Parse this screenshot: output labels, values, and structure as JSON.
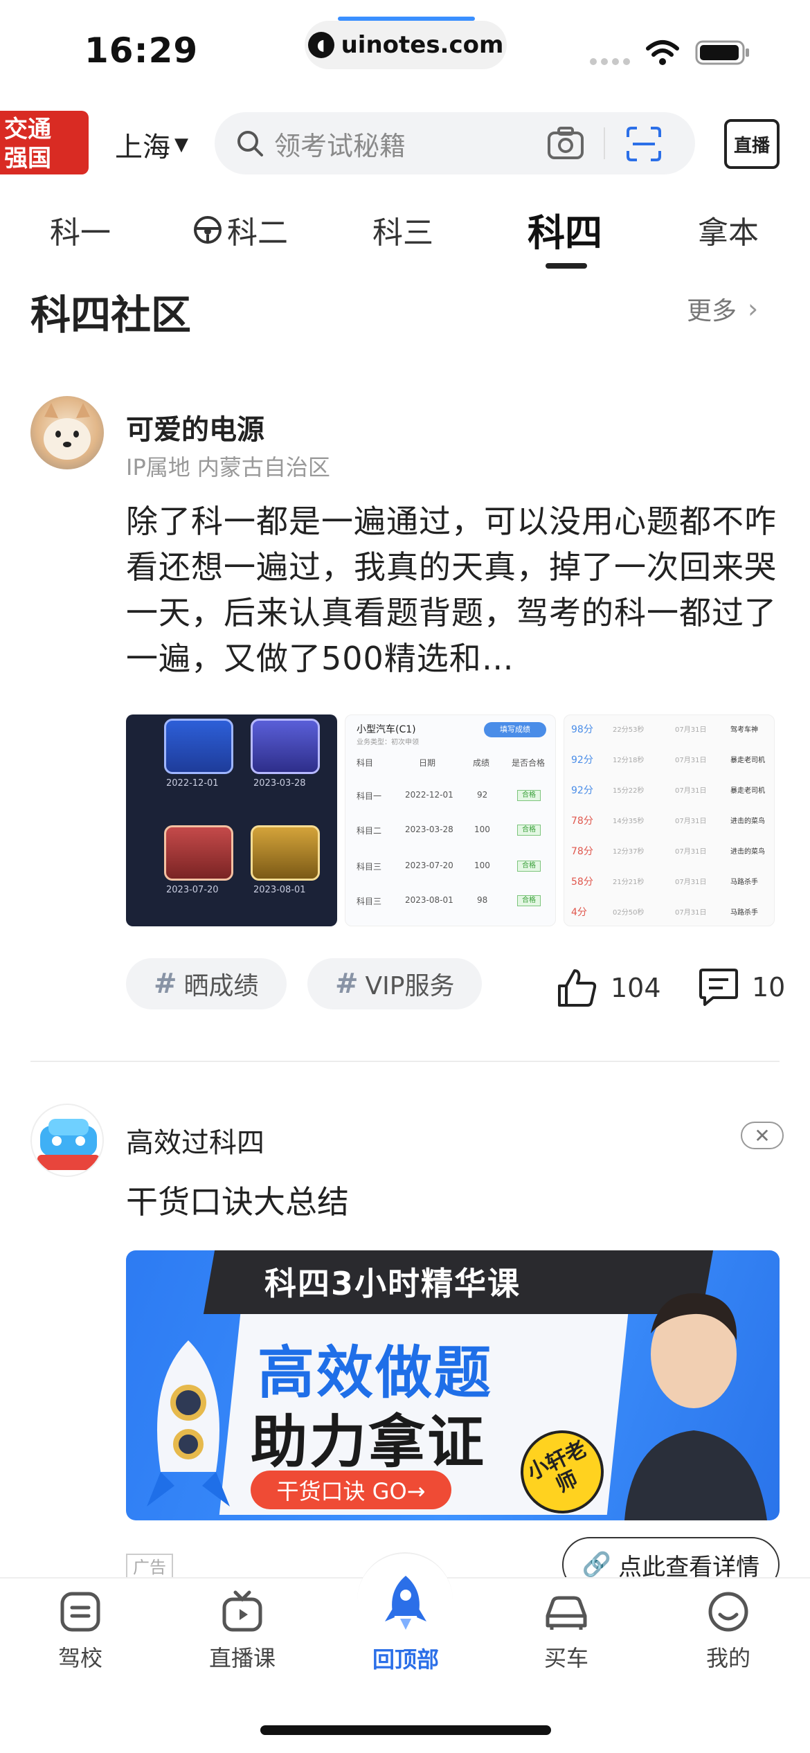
{
  "status_bar": {
    "time": "16:29",
    "url": "uinotes.com"
  },
  "header": {
    "logo_text": [
      "交通",
      "强国"
    ],
    "city": "上海",
    "search_placeholder": "领考试秘籍",
    "live_label": "直播"
  },
  "tabs": [
    {
      "label": "科一"
    },
    {
      "label": "科二"
    },
    {
      "label": "科三"
    },
    {
      "label": "科四",
      "active": true
    },
    {
      "label": "拿本"
    }
  ],
  "section": {
    "title": "科四社区",
    "more": "更多"
  },
  "post1": {
    "author": "可爱的电源",
    "ip": "IP属地 内蒙古自治区",
    "text": "除了科一都是一遍通过，可以没用心题都不咋看还想一遍过，我真的天真，掉了一次回来哭一天，后来认真看题背题，驾考的科一都过了一遍，又做了500精选和…",
    "thumb1_dates": [
      "2022-12-01",
      "2023-03-28",
      "2023-07-20",
      "2023-08-01"
    ],
    "thumb2": {
      "title": "小型汽车(C1)",
      "subtitle": "业务类型：初次申领",
      "button": "填写成绩",
      "headers": [
        "科目",
        "日期",
        "成绩",
        "是否合格"
      ],
      "rows": [
        [
          "科目一",
          "2022-12-01",
          "92",
          "合格"
        ],
        [
          "科目二",
          "2023-03-28",
          "100",
          "合格"
        ],
        [
          "科目三",
          "2023-07-20",
          "100",
          "合格"
        ],
        [
          "科目三",
          "2023-08-01",
          "98",
          "合格"
        ]
      ]
    },
    "thumb3_rows": [
      [
        "98分",
        "22分53秒",
        "07月31日",
        "驾考车神"
      ],
      [
        "92分",
        "12分18秒",
        "07月31日",
        "暴走老司机"
      ],
      [
        "92分",
        "15分22秒",
        "07月31日",
        "暴走老司机"
      ],
      [
        "78分",
        "14分35秒",
        "07月31日",
        "进击的菜鸟"
      ],
      [
        "78分",
        "12分37秒",
        "07月31日",
        "进击的菜鸟"
      ],
      [
        "58分",
        "21分21秒",
        "07月31日",
        "马路杀手"
      ],
      [
        "4分",
        "02分50秒",
        "07月31日",
        "马路杀手"
      ]
    ],
    "tags": [
      "晒成绩",
      "VIP服务"
    ],
    "likes": "104",
    "comments": "10"
  },
  "post2": {
    "author": "高效过科四",
    "text": "干货口诀大总结",
    "ad": {
      "subtitle": "科四3小时精华课",
      "line1": "高效做题",
      "line2": "助力拿证",
      "cta": "干货口诀 GO→",
      "teacher": "小轩老师"
    },
    "ad_label": "广告",
    "detail_button": "点此查看详情"
  },
  "bottom_nav": [
    {
      "label": "驾校"
    },
    {
      "label": "直播课"
    },
    {
      "label": "回顶部",
      "active": true
    },
    {
      "label": "买车"
    },
    {
      "label": "我的"
    }
  ],
  "colors": {
    "accent": "#2b6fe8",
    "logo_red": "#d92b23",
    "score_blue": "#4a8de8",
    "score_red": "#e0574d"
  }
}
